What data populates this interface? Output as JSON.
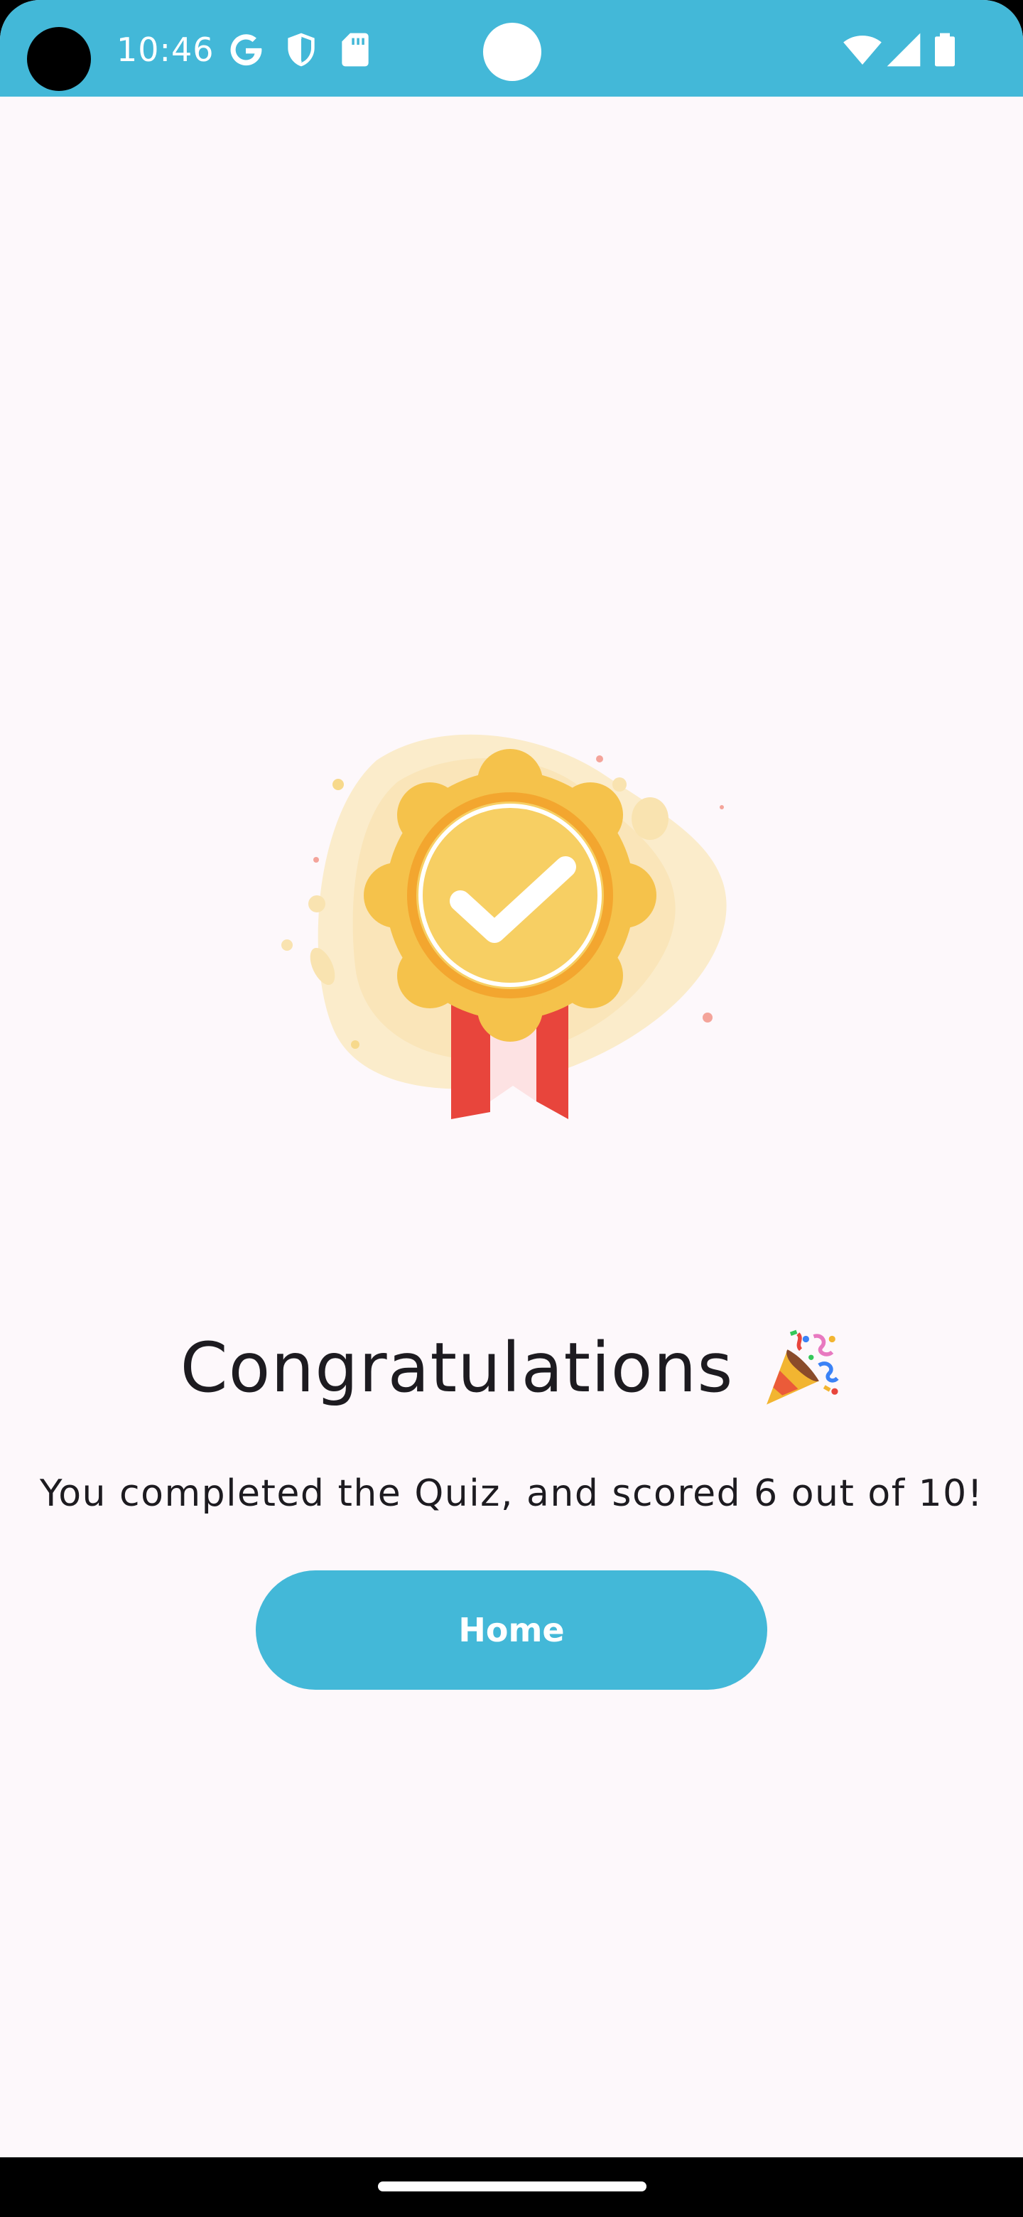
{
  "status_bar": {
    "time": "10:46",
    "icons": [
      "google-icon",
      "shield-icon",
      "sd-card-icon",
      "wifi-icon",
      "signal-icon",
      "battery-icon"
    ],
    "background_color": "#43b8d8"
  },
  "result": {
    "illustration": "medal-check-icon",
    "title": "Congratulations",
    "title_emoji": "party-popper-icon",
    "message": "You completed the Quiz, and scored 6 out of 10!",
    "score": 6,
    "total": 10
  },
  "actions": {
    "home_label": "Home"
  },
  "colors": {
    "accent": "#43b8d8",
    "background": "#fdf8fb",
    "text": "#1d1b20",
    "medal_gold": "#f5c24b",
    "ribbon_red": "#e8453c"
  }
}
